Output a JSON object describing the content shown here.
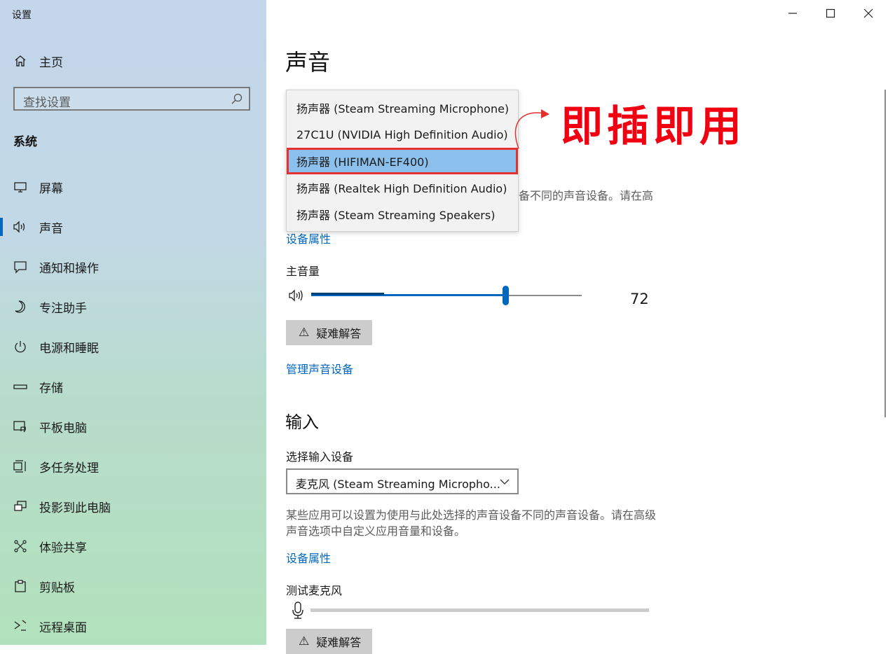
{
  "window": {
    "title": "设置"
  },
  "sidebar": {
    "home_label": "主页",
    "search_placeholder": "查找设置",
    "section_heading": "系统",
    "items": [
      {
        "label": "屏幕",
        "icon": "monitor-icon"
      },
      {
        "label": "声音",
        "icon": "speaker-icon",
        "active": true
      },
      {
        "label": "通知和操作",
        "icon": "notification-icon"
      },
      {
        "label": "专注助手",
        "icon": "moon-icon"
      },
      {
        "label": "电源和睡眠",
        "icon": "power-icon"
      },
      {
        "label": "存储",
        "icon": "storage-icon"
      },
      {
        "label": "平板电脑",
        "icon": "tablet-icon"
      },
      {
        "label": "多任务处理",
        "icon": "multitask-icon"
      },
      {
        "label": "投影到此电脑",
        "icon": "project-icon"
      },
      {
        "label": "体验共享",
        "icon": "share-icon"
      },
      {
        "label": "剪贴板",
        "icon": "clipboard-icon"
      },
      {
        "label": "远程桌面",
        "icon": "remote-icon"
      }
    ]
  },
  "main": {
    "title": "声音",
    "output": {
      "dropdown_options": [
        "扬声器 (Steam Streaming Microphone)",
        "27C1U (NVIDIA High Definition Audio)",
        "扬声器 (HIFIMAN-EF400)",
        "扬声器 (Realtek High Definition Audio)",
        "扬声器 (Steam Streaming Speakers)"
      ],
      "selected_index": 2,
      "partial_desc": "备不同的声音设备。请在高",
      "device_properties_link": "设备属性",
      "volume_label": "主音量",
      "volume_value": "72",
      "volume_level": 0.72,
      "volume_peak": 0.27,
      "troubleshoot_label": "疑难解答",
      "manage_link": "管理声音设备"
    },
    "input": {
      "heading": "输入",
      "select_label": "选择输入设备",
      "select_value": "麦克风 (Steam Streaming Micropho...",
      "description": "某些应用可以设置为使用与此处选择的声音设备不同的声音设备。请在高级声音选项中自定义应用音量和设备。",
      "device_properties_link": "设备属性",
      "test_label": "测试麦克风",
      "troubleshoot_label": "疑难解答"
    }
  },
  "annotation": {
    "text": "即插即用",
    "color": "#f00010"
  },
  "colors": {
    "accent": "#0067c0",
    "highlight": "#e53030"
  }
}
